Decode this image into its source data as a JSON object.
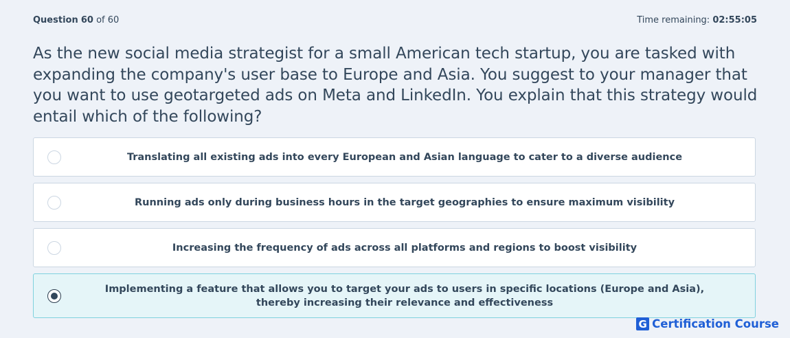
{
  "header": {
    "question_label": "Question",
    "current": "60",
    "of_label": "of",
    "total": "60",
    "time_label": "Time remaining:",
    "time_value": "02:55:05"
  },
  "question": {
    "text": "As the new social media strategist for a small American tech startup, you are tasked with expanding the company's user base to Europe and Asia. You suggest to your manager that you want to use geotargeted ads on Meta and LinkedIn. You explain that this strategy would entail which of the following?"
  },
  "options": [
    {
      "label": "Translating all existing ads into every European and Asian language to cater to a diverse audience",
      "selected": false
    },
    {
      "label": "Running ads only during business hours in the target geographies to ensure maximum visibility",
      "selected": false
    },
    {
      "label": "Increasing the frequency of ads across all platforms and regions to boost visibility",
      "selected": false
    },
    {
      "label": "Implementing a feature that allows you to target your ads to users in specific locations (Europe and Asia), thereby increasing their relevance and effectiveness",
      "selected": true
    }
  ],
  "brand": {
    "mark": "G",
    "name": "Certification Course",
    "color": "#1f5fd6"
  },
  "colors": {
    "background": "#eef2f8",
    "text": "#33475b",
    "selected_bg": "#e5f5f8",
    "selected_border": "#7fd1de"
  }
}
